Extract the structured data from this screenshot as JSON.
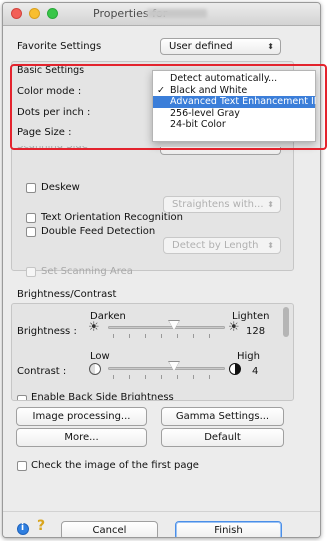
{
  "window": {
    "title": "Properties for"
  },
  "favorite": {
    "label": "Favorite Settings",
    "value": "User defined"
  },
  "basic": {
    "header": "Basic Settings",
    "color_mode_label": "Color mode :",
    "dpi_label": "Dots per inch :",
    "page_size_label": "Page Size :"
  },
  "color_menu": {
    "items": [
      {
        "label": "Detect automatically...",
        "checked": false,
        "selected": false
      },
      {
        "label": "Black and White",
        "checked": true,
        "selected": false
      },
      {
        "label": "Advanced Text Enhancement II",
        "checked": false,
        "selected": true
      },
      {
        "label": "256-level Gray",
        "checked": false,
        "selected": false
      },
      {
        "label": "24-bit Color",
        "checked": false,
        "selected": false
      }
    ],
    "check_glyph": "✓"
  },
  "deskew": {
    "label": "Deskew",
    "option": "Straightens with..."
  },
  "text_orientation": {
    "label": "Text Orientation Recognition"
  },
  "double_feed": {
    "label": "Double Feed Detection",
    "option": "Detect by Length"
  },
  "scanning_area": {
    "label": "Set Scanning Area"
  },
  "bc": {
    "header": "Brightness/Contrast",
    "brightness_label": "Brightness :",
    "darken": "Darken",
    "lighten": "Lighten",
    "brightness_value": "128",
    "contrast_label": "Contrast :",
    "low": "Low",
    "high": "High",
    "contrast_value": "4",
    "backside_label": "Enable Back Side Brightness"
  },
  "buttons": {
    "image_processing": "Image processing...",
    "gamma": "Gamma Settings...",
    "more": "More...",
    "default": "Default",
    "cancel": "Cancel",
    "finish": "Finish"
  },
  "check_first_page": {
    "label": "Check the image of the first page"
  },
  "colors": {
    "accent": "#3b7ed9",
    "highlight_box": "#e3232d"
  }
}
